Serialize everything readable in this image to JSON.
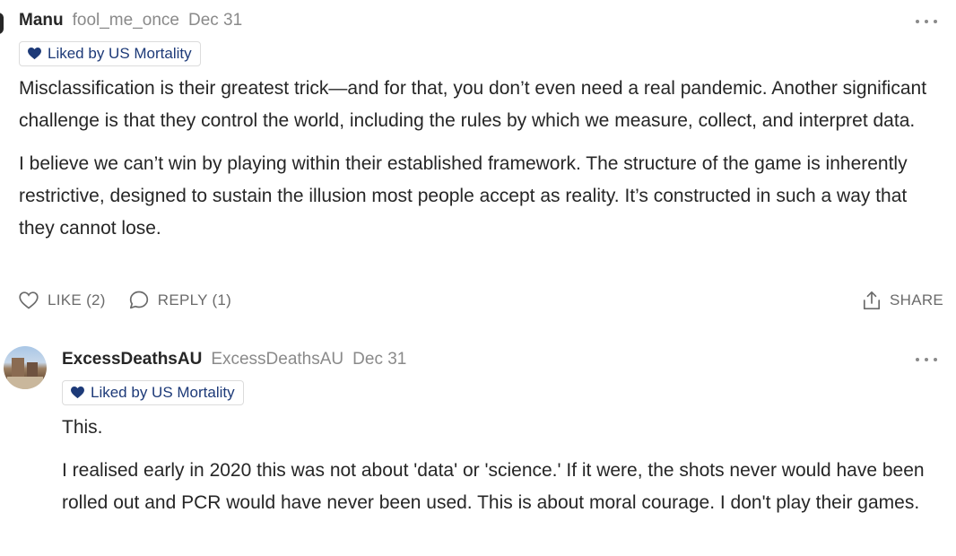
{
  "comments": [
    {
      "author": "Manu",
      "handle": "fool_me_once",
      "date": "Dec 31",
      "liked_by": "Liked by US Mortality",
      "paragraphs": [
        "Misclassification is their greatest trick—and for that, you don’t even need a real pandemic. Another significant challenge is that they control the world, including the rules by which we measure, collect, and interpret data.",
        "I believe we can’t win by playing within their established framework. The structure of the game is inherently restrictive, designed to sustain the illusion most people accept as reality. It’s constructed in such a way that they cannot lose."
      ],
      "like_label": "LIKE (2)",
      "reply_label": "REPLY (1)",
      "share_label": "SHARE"
    },
    {
      "author": "ExcessDeathsAU",
      "handle": "ExcessDeathsAU",
      "date": "Dec 31",
      "liked_by": "Liked by US Mortality",
      "paragraphs": [
        "This.",
        "I realised early in 2020 this was not about 'data' or 'science.' If it were, the shots never would have been rolled out and PCR would have never been used. This is about moral courage. I don't play their games."
      ]
    }
  ],
  "colors": {
    "liked_heart": "#1d3a78",
    "muted_text": "#8a8a8a",
    "action_text": "#6b6b6b"
  },
  "icons": [
    "heart-icon",
    "chat-bubble-icon",
    "share-icon",
    "more-options-icon",
    "liked-heart-icon"
  ]
}
